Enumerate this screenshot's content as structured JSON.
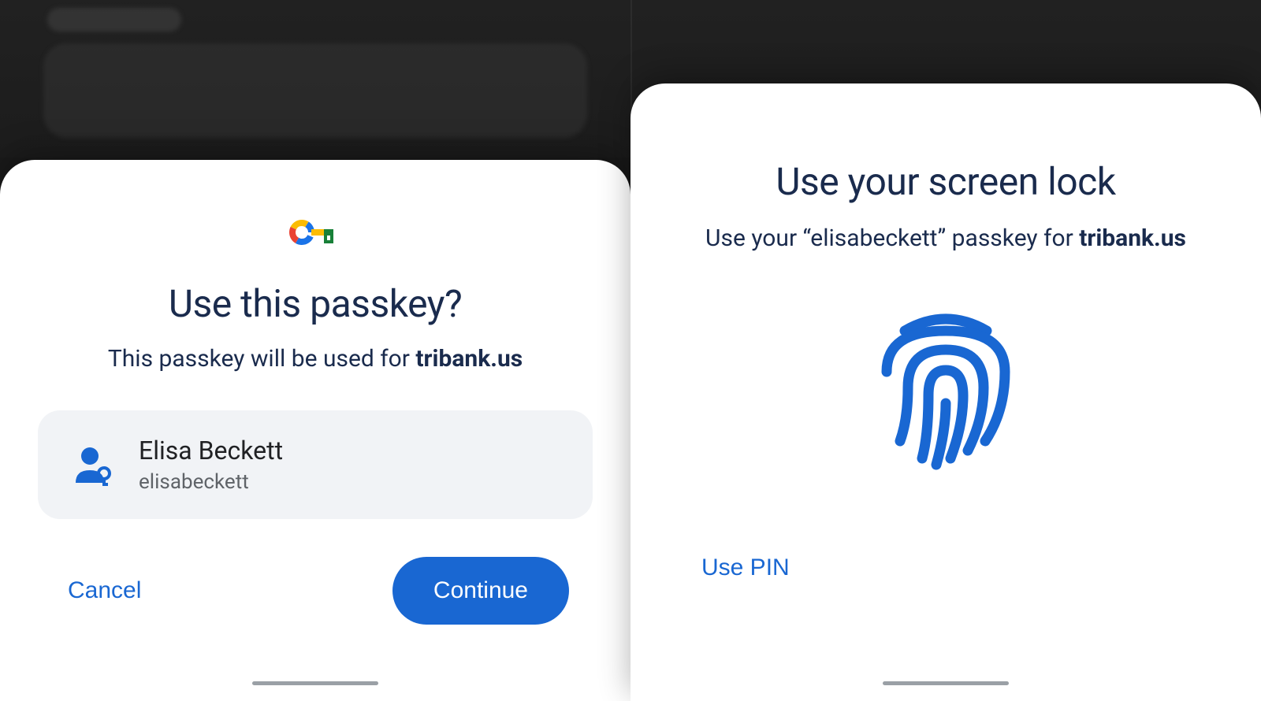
{
  "left": {
    "title": "Use this passkey?",
    "subtitle_prefix": "This passkey will be used for ",
    "subtitle_bold": "tribank.us",
    "account": {
      "name": "Elisa Beckett",
      "username": "elisabeckett"
    },
    "cancel_label": "Cancel",
    "continue_label": "Continue"
  },
  "right": {
    "title": "Use your screen lock",
    "subtitle_prefix": "Use your “elisabeckett” passkey for ",
    "subtitle_bold": "tribank.us",
    "use_pin_label": "Use PIN"
  }
}
